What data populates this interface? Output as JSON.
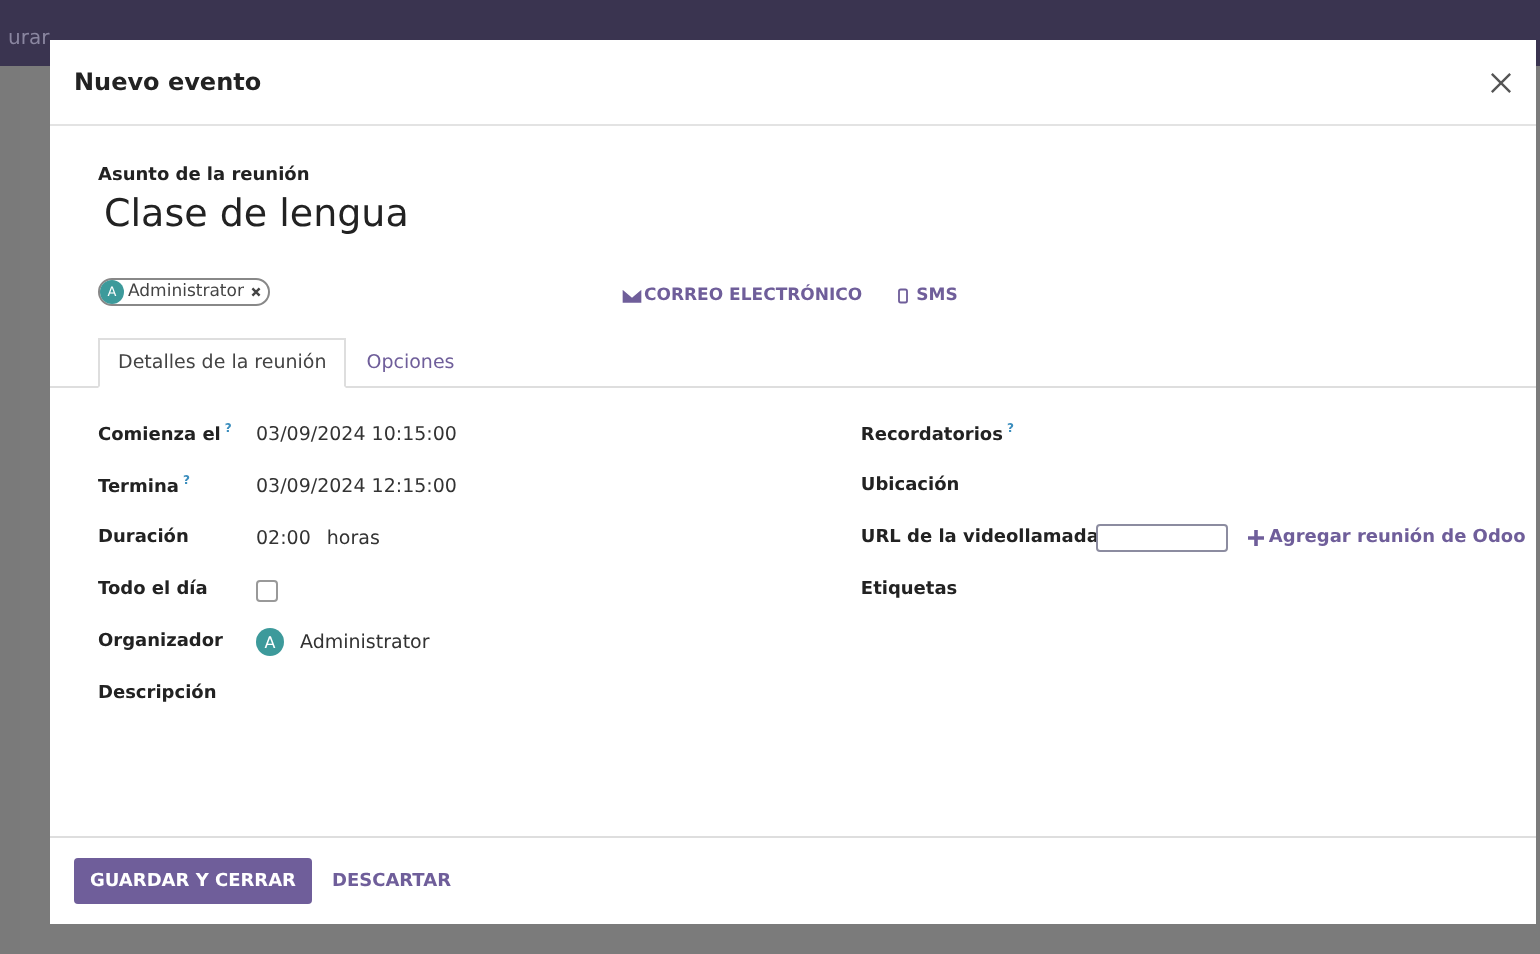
{
  "backdrop": {
    "top_bar_text": "urar"
  },
  "dialog": {
    "title": "Nuevo evento"
  },
  "subject": {
    "label": "Asunto de la reunión",
    "value": "Clase de lengua"
  },
  "attendees": [
    {
      "initial": "A",
      "name": "Administrator",
      "color": "#3d9a9b"
    }
  ],
  "actions": [
    {
      "kind": "email",
      "label": "CORREO ELECTRÓNICO"
    },
    {
      "kind": "sms",
      "label": "SMS"
    }
  ],
  "tabs": [
    {
      "label": "Detalles de la reunión",
      "selected": true
    },
    {
      "label": "Opciones",
      "selected": false
    }
  ],
  "left_fields": [
    {
      "kind": "text",
      "label": "Comienza el",
      "hint": "?",
      "value": "03/09/2024 10:15:00"
    },
    {
      "kind": "text",
      "label": "Termina",
      "hint": "?",
      "value": "03/09/2024 12:15:00"
    },
    {
      "kind": "duration",
      "label": "Duración",
      "value": "02:00",
      "unit": "horas"
    },
    {
      "kind": "checkbox",
      "label": "Todo el día",
      "checked": false
    },
    {
      "kind": "user",
      "label": "Organizador",
      "initial": "A",
      "value": "Administrator"
    },
    {
      "kind": "empty",
      "label": "Descripción"
    }
  ],
  "right_fields": [
    {
      "kind": "empty",
      "label": "Recordatorios",
      "hint": "?"
    },
    {
      "kind": "empty",
      "label": "Ubicación"
    },
    {
      "kind": "url",
      "label": "URL de la videollamada",
      "link": "Agregar reunión de Odoo"
    },
    {
      "kind": "empty",
      "label": "Etiquetas"
    }
  ],
  "buttons": [
    {
      "kind": "primary",
      "label": "GUARDAR Y CERRAR"
    },
    {
      "kind": "link",
      "label": "DESCARTAR"
    }
  ]
}
